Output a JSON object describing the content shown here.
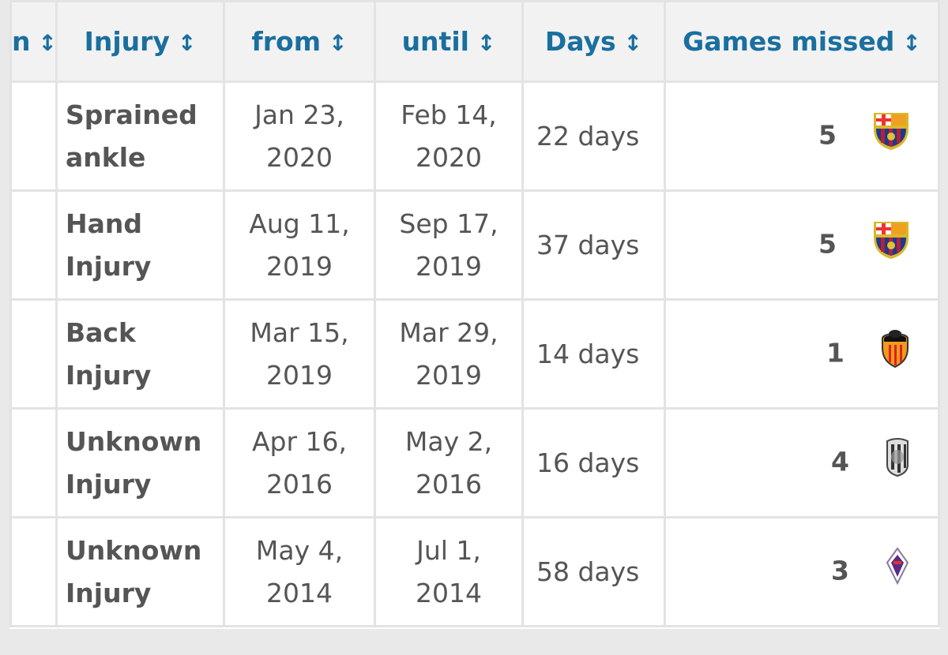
{
  "table": {
    "headers": [
      {
        "label": "n",
        "sort": "↕"
      },
      {
        "label": "Injury",
        "sort": "↕"
      },
      {
        "label": "from",
        "sort": "↕"
      },
      {
        "label": "until",
        "sort": "↕"
      },
      {
        "label": "Days",
        "sort": "↕"
      },
      {
        "label": "Games missed",
        "sort": "↕"
      }
    ],
    "rows": [
      {
        "injury": [
          "Sprained",
          "ankle"
        ],
        "from": [
          "Jan 23,",
          "2020"
        ],
        "until": [
          "Feb 14,",
          "2020"
        ],
        "days": "22 days",
        "games": "5",
        "club_icon": "barcelona-crest-icon"
      },
      {
        "injury": [
          "Hand",
          "Injury"
        ],
        "from": [
          "Aug 11,",
          "2019"
        ],
        "until": [
          "Sep 17,",
          "2019"
        ],
        "days": "37 days",
        "games": "5",
        "club_icon": "barcelona-crest-icon"
      },
      {
        "injury": [
          "Back",
          "Injury"
        ],
        "from": [
          "Mar 15,",
          "2019"
        ],
        "until": [
          "Mar 29,",
          "2019"
        ],
        "days": "14 days",
        "games": "1",
        "club_icon": "valencia-crest-icon"
      },
      {
        "injury": [
          "Unknown",
          "Injury"
        ],
        "from": [
          "Apr 16,",
          "2016"
        ],
        "until": [
          "May 2,",
          "2016"
        ],
        "days": "16 days",
        "games": "4",
        "club_icon": "juventus-crest-icon"
      },
      {
        "injury": [
          "Unknown",
          "Injury"
        ],
        "from": [
          "May 4,",
          "2014"
        ],
        "until": [
          "Jul 1,",
          "2014"
        ],
        "days": "58 days",
        "games": "3",
        "club_icon": "fiorentina-crest-icon"
      }
    ]
  },
  "colors": {
    "header_text": "#1a6f9f",
    "cell_text": "#555555",
    "header_bg": "#f2f2f2",
    "border": "#e3e3e3"
  }
}
